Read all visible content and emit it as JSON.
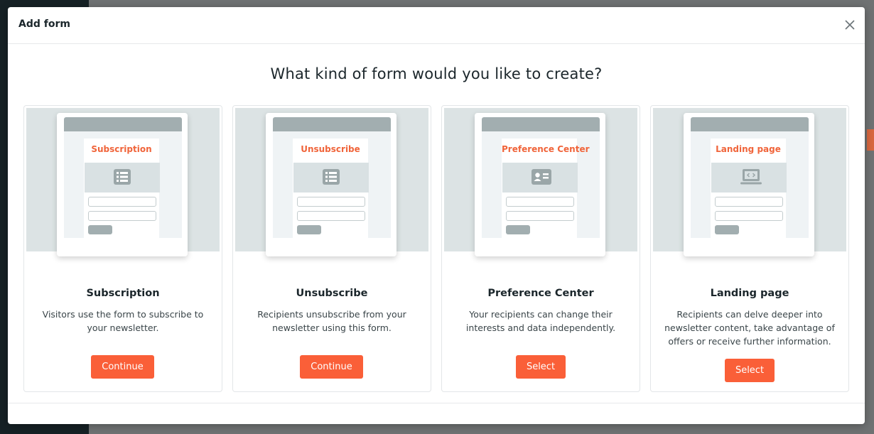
{
  "modal": {
    "title": "Add form",
    "close_icon": "close-icon",
    "heading": "What kind of form would you like to create?"
  },
  "cards": [
    {
      "preview_title": "Subscription",
      "preview_icon": "list-icon",
      "title": "Subscription",
      "description": "Visitors use the form to subscribe to your newsletter.",
      "button": "Continue"
    },
    {
      "preview_title": "Unsubscribe",
      "preview_icon": "list-icon",
      "title": "Unsubscribe",
      "description": "Recipients unsubscribe from your newsletter using this form.",
      "button": "Continue"
    },
    {
      "preview_title": "Preference Center",
      "preview_icon": "id-card-icon",
      "title": "Preference Center",
      "description": "Your recipients can change their interests and data independently.",
      "button": "Select"
    },
    {
      "preview_title": "Landing page",
      "preview_icon": "laptop-code-icon",
      "title": "Landing page",
      "description": "Recipients can delve deeper into newsletter content, take advantage of offers or receive further information.",
      "button": "Select"
    }
  ],
  "colors": {
    "accent": "#fa5f38",
    "preview_title": "#f0643a",
    "text": "#1b262b"
  }
}
